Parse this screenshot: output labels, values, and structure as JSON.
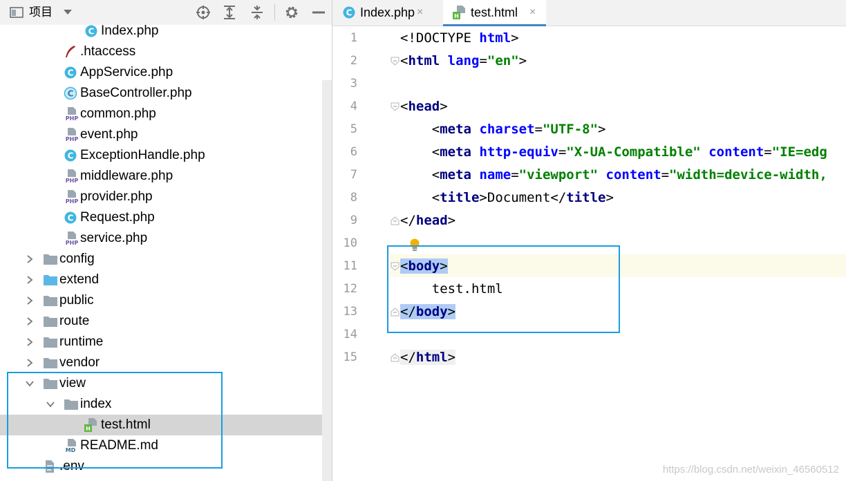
{
  "project_panel": {
    "title": "项目",
    "tree": [
      {
        "label": "Index.php",
        "icon": "php-class-icon",
        "depth": 4,
        "selected": false
      },
      {
        "label": ".htaccess",
        "icon": "htaccess-feather-icon",
        "depth": 3,
        "selected": false
      },
      {
        "label": "AppService.php",
        "icon": "php-class-icon",
        "depth": 3,
        "selected": false
      },
      {
        "label": "BaseController.php",
        "icon": "php-abstract-class-icon",
        "depth": 3,
        "selected": false
      },
      {
        "label": "common.php",
        "icon": "php-file-icon",
        "depth": 3,
        "selected": false
      },
      {
        "label": "event.php",
        "icon": "php-file-icon",
        "depth": 3,
        "selected": false
      },
      {
        "label": "ExceptionHandle.php",
        "icon": "php-class-icon",
        "depth": 3,
        "selected": false
      },
      {
        "label": "middleware.php",
        "icon": "php-file-icon",
        "depth": 3,
        "selected": false
      },
      {
        "label": "provider.php",
        "icon": "php-file-icon",
        "depth": 3,
        "selected": false
      },
      {
        "label": "Request.php",
        "icon": "php-class-icon",
        "depth": 3,
        "selected": false
      },
      {
        "label": "service.php",
        "icon": "php-file-icon",
        "depth": 3,
        "selected": false
      },
      {
        "label": "config",
        "icon": "folder-icon",
        "depth": 2,
        "selected": false,
        "chevron": "right"
      },
      {
        "label": "extend",
        "icon": "source-folder-icon",
        "depth": 2,
        "selected": false,
        "chevron": "right"
      },
      {
        "label": "public",
        "icon": "folder-icon",
        "depth": 2,
        "selected": false,
        "chevron": "right"
      },
      {
        "label": "route",
        "icon": "folder-icon",
        "depth": 2,
        "selected": false,
        "chevron": "right"
      },
      {
        "label": "runtime",
        "icon": "folder-icon",
        "depth": 2,
        "selected": false,
        "chevron": "right"
      },
      {
        "label": "vendor",
        "icon": "folder-icon",
        "depth": 2,
        "selected": false,
        "chevron": "right"
      },
      {
        "label": "view",
        "icon": "folder-icon",
        "depth": 2,
        "selected": false,
        "chevron": "down"
      },
      {
        "label": "index",
        "icon": "folder-icon",
        "depth": 3,
        "selected": false,
        "chevron": "down"
      },
      {
        "label": "test.html",
        "icon": "html-file-icon",
        "depth": 4,
        "selected": true
      },
      {
        "label": "README.md",
        "icon": "markdown-file-icon",
        "depth": 3,
        "selected": false
      },
      {
        "label": ".env",
        "icon": "text-file-icon",
        "depth": 2,
        "selected": false
      }
    ]
  },
  "editor": {
    "tabs": [
      {
        "label": "Index.php",
        "icon": "php-class-icon",
        "active": false,
        "close": "×"
      },
      {
        "label": "test.html",
        "icon": "html-file-icon",
        "active": true,
        "close": "×"
      }
    ],
    "lines": [
      {
        "n": "1",
        "tokens": [
          {
            "t": "<!DOCTYPE ",
            "c": "doctype"
          },
          {
            "t": "html",
            "c": "attr"
          },
          {
            "t": ">",
            "c": "punc"
          }
        ]
      },
      {
        "n": "2",
        "tokens": [
          {
            "t": "<",
            "c": "punc"
          },
          {
            "t": "html",
            "c": "tag"
          },
          {
            "t": " ",
            "c": "text"
          },
          {
            "t": "lang",
            "c": "attr"
          },
          {
            "t": "=",
            "c": "punc"
          },
          {
            "t": "\"en\"",
            "c": "str"
          },
          {
            "t": ">",
            "c": "punc"
          }
        ]
      },
      {
        "n": "3",
        "tokens": []
      },
      {
        "n": "4",
        "tokens": [
          {
            "t": "<",
            "c": "punc"
          },
          {
            "t": "head",
            "c": "tag"
          },
          {
            "t": ">",
            "c": "punc"
          }
        ]
      },
      {
        "n": "5",
        "tokens": [
          {
            "t": "    ",
            "c": "text"
          },
          {
            "t": "<",
            "c": "punc"
          },
          {
            "t": "meta",
            "c": "tag"
          },
          {
            "t": " ",
            "c": "text"
          },
          {
            "t": "charset",
            "c": "attr"
          },
          {
            "t": "=",
            "c": "punc"
          },
          {
            "t": "\"UTF-8\"",
            "c": "str"
          },
          {
            "t": ">",
            "c": "punc"
          }
        ]
      },
      {
        "n": "6",
        "tokens": [
          {
            "t": "    ",
            "c": "text"
          },
          {
            "t": "<",
            "c": "punc"
          },
          {
            "t": "meta",
            "c": "tag"
          },
          {
            "t": " ",
            "c": "text"
          },
          {
            "t": "http-equiv",
            "c": "attr"
          },
          {
            "t": "=",
            "c": "punc"
          },
          {
            "t": "\"X-UA-Compatible\"",
            "c": "str"
          },
          {
            "t": " ",
            "c": "text"
          },
          {
            "t": "content",
            "c": "attr"
          },
          {
            "t": "=",
            "c": "punc"
          },
          {
            "t": "\"IE=edg",
            "c": "str"
          }
        ]
      },
      {
        "n": "7",
        "tokens": [
          {
            "t": "    ",
            "c": "text"
          },
          {
            "t": "<",
            "c": "punc"
          },
          {
            "t": "meta",
            "c": "tag"
          },
          {
            "t": " ",
            "c": "text"
          },
          {
            "t": "name",
            "c": "attr"
          },
          {
            "t": "=",
            "c": "punc"
          },
          {
            "t": "\"viewport\"",
            "c": "str"
          },
          {
            "t": " ",
            "c": "text"
          },
          {
            "t": "content",
            "c": "attr"
          },
          {
            "t": "=",
            "c": "punc"
          },
          {
            "t": "\"width=device-width,",
            "c": "str"
          }
        ]
      },
      {
        "n": "8",
        "tokens": [
          {
            "t": "    ",
            "c": "text"
          },
          {
            "t": "<",
            "c": "punc"
          },
          {
            "t": "title",
            "c": "tag"
          },
          {
            "t": ">",
            "c": "punc"
          },
          {
            "t": "Document",
            "c": "text"
          },
          {
            "t": "</",
            "c": "punc"
          },
          {
            "t": "title",
            "c": "tag"
          },
          {
            "t": ">",
            "c": "punc"
          }
        ]
      },
      {
        "n": "9",
        "tokens": [
          {
            "t": "</",
            "c": "punc"
          },
          {
            "t": "head",
            "c": "tag"
          },
          {
            "t": ">",
            "c": "punc"
          }
        ]
      },
      {
        "n": "10",
        "tokens": []
      },
      {
        "n": "11",
        "tokens": [
          {
            "t": "<",
            "c": "punc",
            "hl": "sel"
          },
          {
            "t": "body",
            "c": "tag",
            "hl": "sel"
          },
          {
            "t": ">",
            "c": "punc",
            "hl": "sel"
          }
        ]
      },
      {
        "n": "12",
        "tokens": [
          {
            "t": "    ",
            "c": "text"
          },
          {
            "t": "test.html",
            "c": "text"
          }
        ]
      },
      {
        "n": "13",
        "tokens": [
          {
            "t": "</",
            "c": "punc",
            "hl": "sel"
          },
          {
            "t": "body",
            "c": "tag",
            "hl": "sel"
          },
          {
            "t": ">",
            "c": "punc",
            "hl": "sel"
          }
        ]
      },
      {
        "n": "14",
        "tokens": []
      },
      {
        "n": "15",
        "tokens": [
          {
            "t": "</",
            "c": "punc",
            "hl": "match"
          },
          {
            "t": "html",
            "c": "tag",
            "hl": "match"
          },
          {
            "t": ">",
            "c": "punc",
            "hl": "match"
          }
        ]
      }
    ]
  },
  "watermark": "https://blog.csdn.net/weixin_46560512",
  "colors": {
    "highlight_box": "#1a9ce0",
    "tag": "#000080",
    "attribute": "#0000ff",
    "string": "#008000",
    "selection": "#aecbf5",
    "caret_line": "#fcfae9"
  }
}
